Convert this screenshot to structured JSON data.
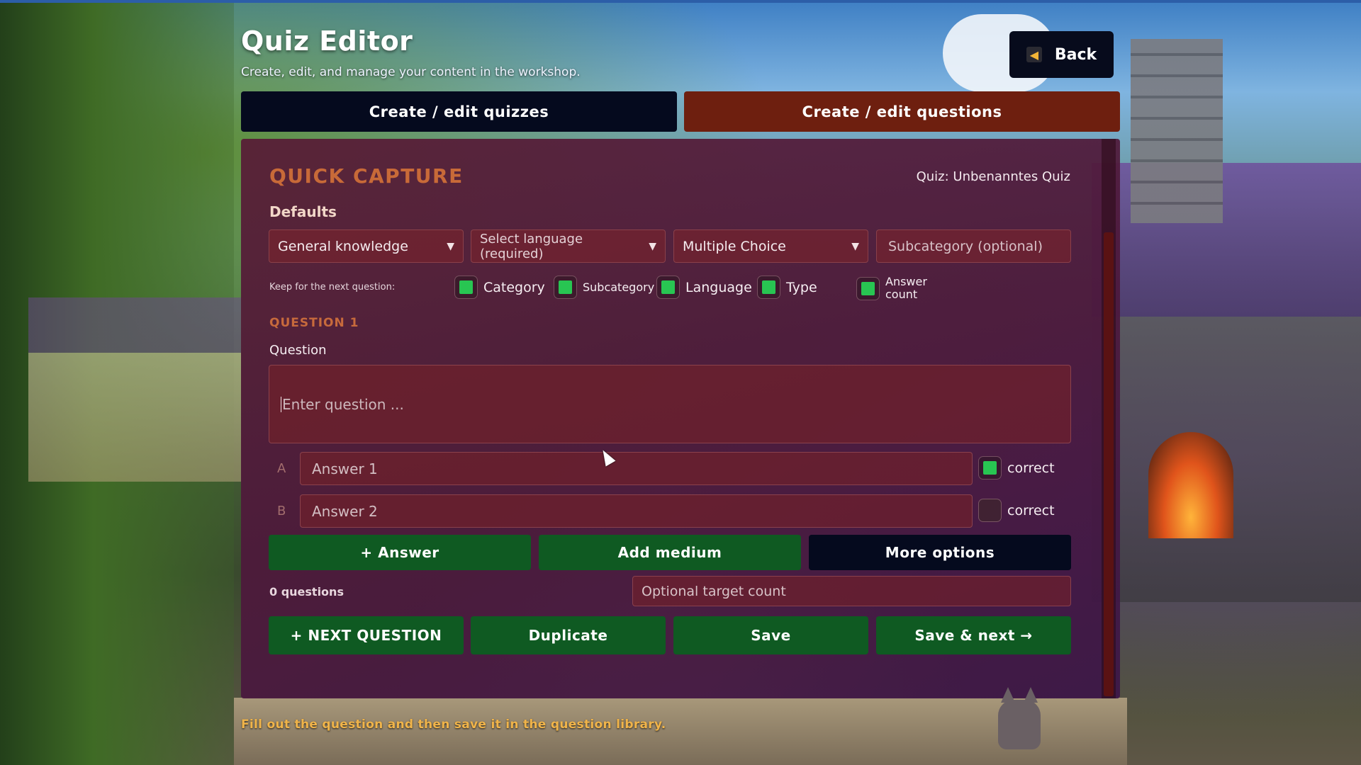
{
  "header": {
    "title": "Quiz Editor",
    "subtitle": "Create, edit, and manage your content in the workshop.",
    "back_label": "Back"
  },
  "tabs": [
    {
      "label": "Create / edit quizzes",
      "active": false
    },
    {
      "label": "Create / edit questions",
      "active": true
    }
  ],
  "capture": {
    "title": "QUICK CAPTURE",
    "quiz_label": "Quiz: Unbenanntes Quiz",
    "defaults_label": "Defaults",
    "category_select": "General knowledge",
    "language_select": "Select language (required)",
    "type_select": "Multiple Choice",
    "subcategory_placeholder": "Subcategory (optional)",
    "keep_label": "Keep for the next question:",
    "keep_options": [
      {
        "label": "Category",
        "checked": true
      },
      {
        "label": "Subcategory",
        "checked": true
      },
      {
        "label": "Language",
        "checked": true
      },
      {
        "label": "Type",
        "checked": true
      },
      {
        "label": "Answer count",
        "checked": true
      }
    ]
  },
  "question": {
    "heading": "QUESTION 1",
    "label": "Question",
    "placeholder": "Enter question ...",
    "answers": [
      {
        "letter": "A",
        "placeholder": "Answer 1",
        "correct_label": "correct",
        "correct": true
      },
      {
        "letter": "B",
        "placeholder": "Answer 2",
        "correct_label": "correct",
        "correct": false
      }
    ]
  },
  "actions": {
    "add_answer": "+ Answer",
    "add_medium": "Add medium",
    "more_options": "More options",
    "question_count": "0 questions",
    "target_placeholder": "Optional target count",
    "next_question": "+ NEXT QUESTION",
    "duplicate": "Duplicate",
    "save": "Save",
    "save_next": "Save & next →"
  },
  "footer_note": "Fill out the question and then save it in the question library.",
  "colors": {
    "accent_orange": "#c86a38",
    "check_green": "#28c552",
    "button_green": "#0f5a22",
    "tab_active": "#6e1f0f",
    "tab_inactive": "#050a1e"
  }
}
